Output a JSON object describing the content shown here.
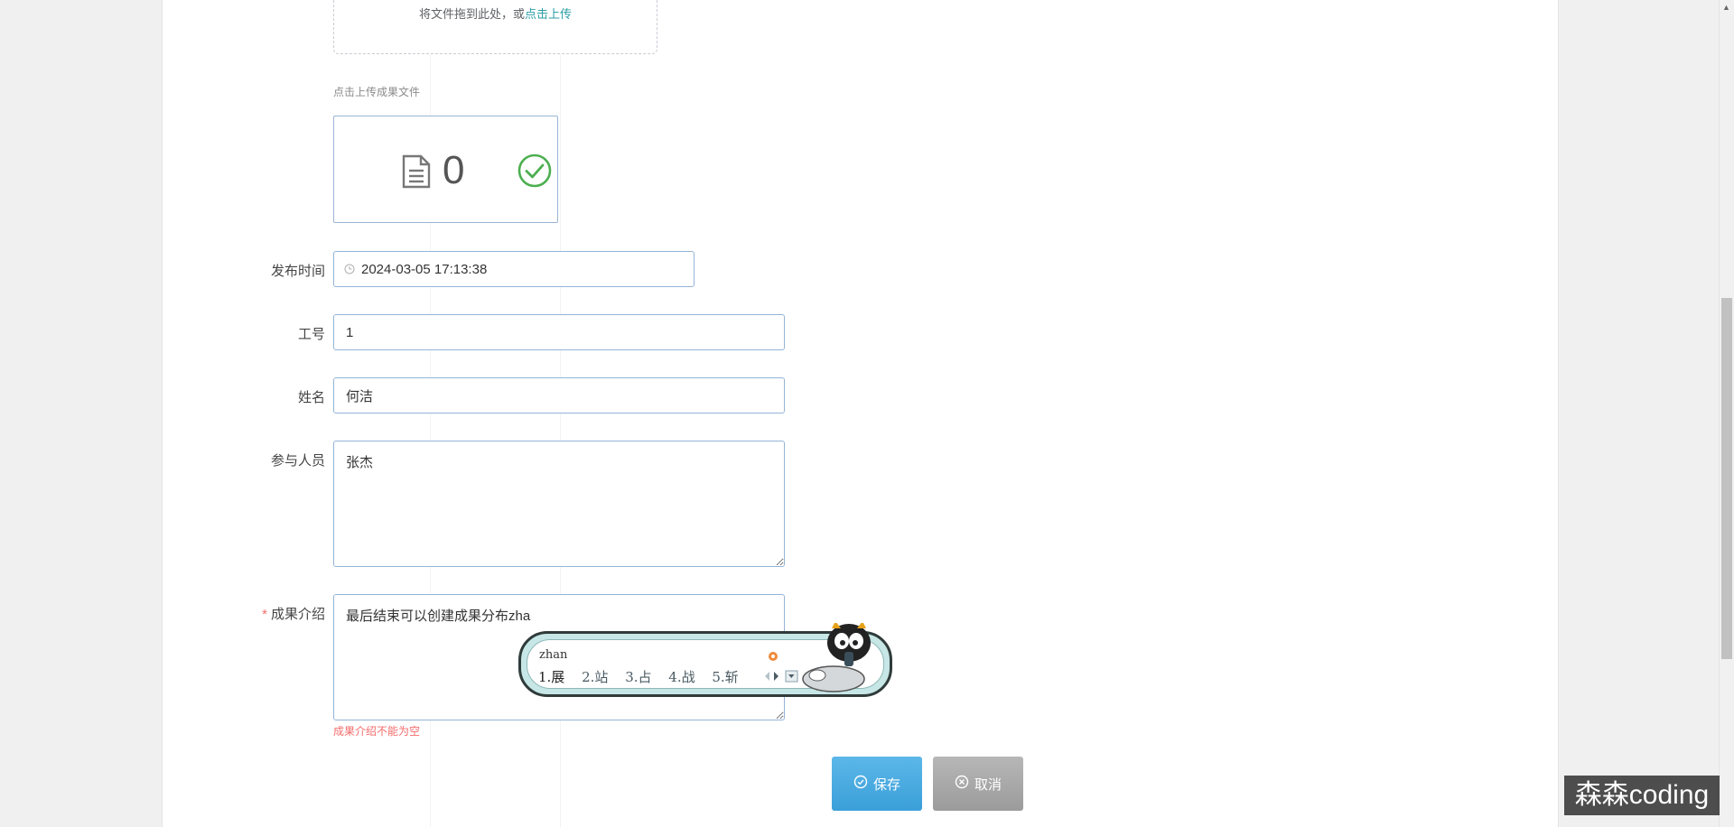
{
  "upload": {
    "drop_text": "将文件拖到此处，或",
    "drop_link": "点击上传",
    "hint": "点击上传成果文件",
    "file_count": "0"
  },
  "form": {
    "publish_time": {
      "label": "发布时间",
      "value": "2024-03-05 17:13:38"
    },
    "employee_id": {
      "label": "工号",
      "value": "1"
    },
    "name": {
      "label": "姓名",
      "value": "何洁"
    },
    "participants": {
      "label": "参与人员",
      "value": "张杰"
    },
    "intro": {
      "required_mark": "*",
      "label": "成果介绍",
      "value": "最后结束可以创建成果分布zha",
      "error": "成果介绍不能为空"
    }
  },
  "buttons": {
    "save": "保存",
    "cancel": "取消"
  },
  "ime": {
    "pinyin": "zhan",
    "candidates": [
      "1.展",
      "2.站",
      "3.占",
      "4.战",
      "5.斩"
    ]
  },
  "watermark": "森森coding",
  "colors": {
    "link": "#2b9ea6",
    "error": "#f56c6c",
    "save_button": "#3a9fd9",
    "cancel_button": "#9b9b9b",
    "success_check": "#4caf50"
  },
  "icons": [
    "document-icon",
    "check-circle-icon",
    "clock-icon",
    "check-circle-outline-icon",
    "close-circle-icon",
    "skin-icon",
    "mascot-icon"
  ]
}
